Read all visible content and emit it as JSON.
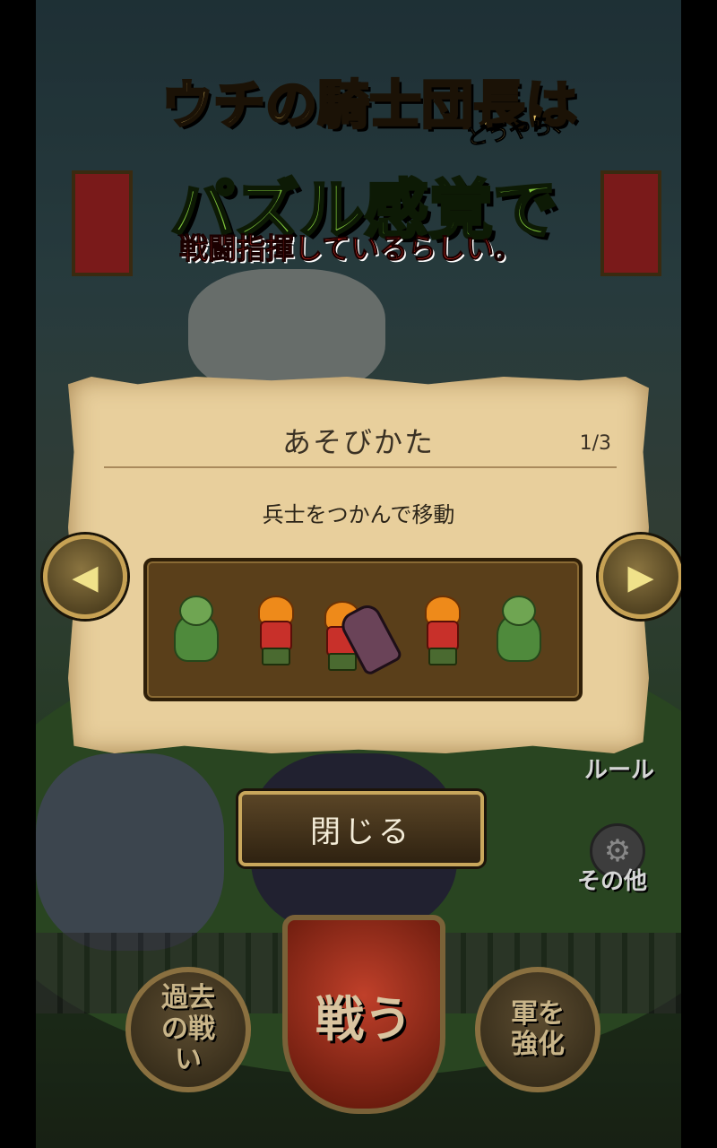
{
  "title_logo": {
    "line1": "ウチの騎士団長は",
    "small": "どうやら、",
    "line2": "パズル感覚で",
    "line3": "戦闘指揮しているらしい。"
  },
  "side_menu": {
    "rules_label": "ルール",
    "other_label": "その他"
  },
  "bottom_menu": {
    "past_battles_label": "過去の戦い",
    "fight_label": "戦う",
    "strengthen_label": "軍を強化"
  },
  "dialog": {
    "title": "あそびかた",
    "page_indicator": "1/3",
    "instruction": "兵士をつかんで移動",
    "close_label": "閉じる",
    "prev_symbol": "◀",
    "next_symbol": "▶"
  },
  "colors": {
    "parchment": "#e8cf9c",
    "gold_border": "#c9a75c",
    "demo_panel": "#5a3f1a"
  }
}
